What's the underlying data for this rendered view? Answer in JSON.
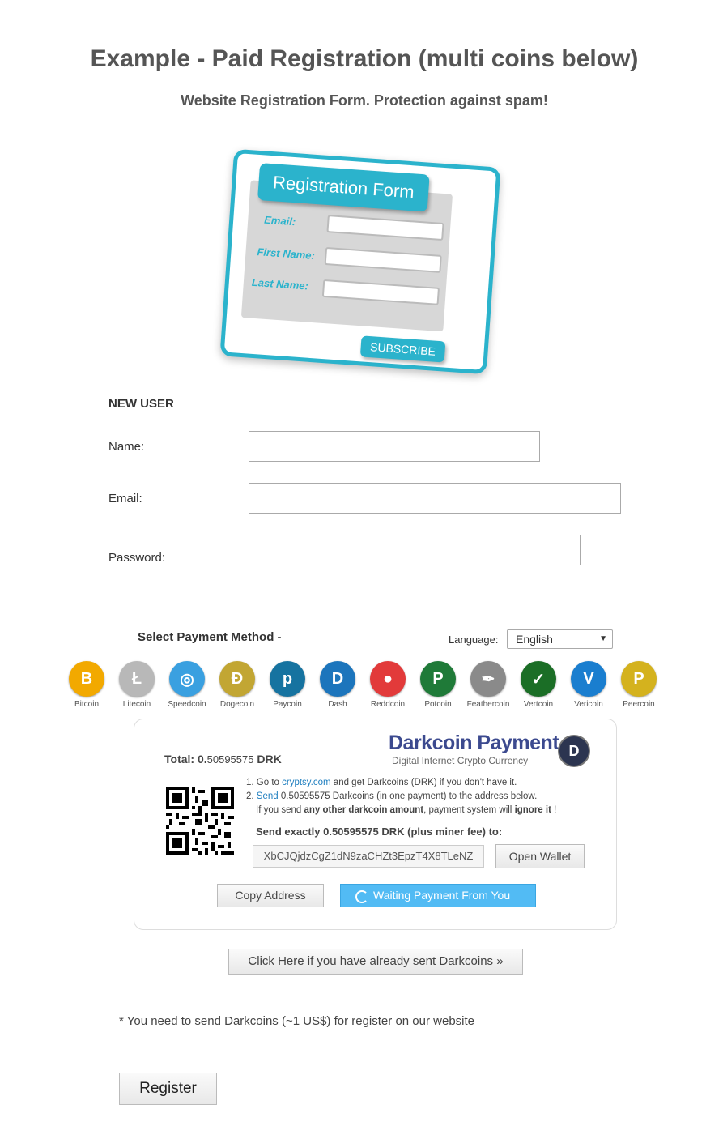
{
  "header": {
    "title": "Example - Paid Registration (multi coins below)",
    "subtitle": "Website Registration Form. Protection against spam!"
  },
  "illustration": {
    "tab": "Registration Form",
    "email_label": "Email:",
    "first_label": "First Name:",
    "last_label": "Last Name:",
    "button": "SUBSCRIBE",
    "accent": "#2bb3cc"
  },
  "form": {
    "heading": "NEW USER",
    "name_label": "Name:",
    "email_label": "Email:",
    "password_label": "Password:",
    "name_value": "",
    "email_value": "",
    "password_value": ""
  },
  "payment": {
    "select_label": "Select Payment Method -",
    "language_label": "Language:",
    "language_value": "English",
    "coins": [
      {
        "name": "Bitcoin",
        "glyph": "B",
        "color": "#f2a900"
      },
      {
        "name": "Litecoin",
        "glyph": "Ł",
        "color": "#b8b8b8"
      },
      {
        "name": "Speedcoin",
        "glyph": "◎",
        "color": "#3aa0e0"
      },
      {
        "name": "Dogecoin",
        "glyph": "Ð",
        "color": "#c2a633"
      },
      {
        "name": "Paycoin",
        "glyph": "p",
        "color": "#1673a0"
      },
      {
        "name": "Dash",
        "glyph": "D",
        "color": "#1c75bc"
      },
      {
        "name": "Reddcoin",
        "glyph": "●",
        "color": "#e23a3a"
      },
      {
        "name": "Potcoin",
        "glyph": "P",
        "color": "#1f7a38"
      },
      {
        "name": "Feathercoin",
        "glyph": "✒",
        "color": "#8a8a8a"
      },
      {
        "name": "Vertcoin",
        "glyph": "✓",
        "color": "#1b6e26"
      },
      {
        "name": "Vericoin",
        "glyph": "V",
        "color": "#1a7ecf"
      },
      {
        "name": "Peercoin",
        "glyph": "P",
        "color": "#d4b21e"
      }
    ]
  },
  "box": {
    "total_label": "Total: 0.",
    "total_num": "50595575",
    "total_unit": " DRK",
    "logo": "Darkcoin Payment",
    "tagline": "Digital Internet Crypto Currency",
    "logo_glyph": "D",
    "step1_pre": "1. Go to ",
    "step1_link": "cryptsy.com",
    "step1_post": " and get Darkcoins (DRK) if you don't have it.",
    "step2_pre": "2. ",
    "step2_link": "Send",
    "step2_post": " 0.50595575 Darkcoins (in one payment) to the address below.",
    "step3_a": "If you send ",
    "step3_b": "any other darkcoin amount",
    "step3_c": ", payment system will ",
    "step3_d": "ignore it",
    "step3_e": " !",
    "send_exact": "Send exactly 0.50595575 DRK (plus miner fee) to:",
    "address": "XbCJQjdzCgZ1dN9zaCHZt3EpzT4X8TLeNZ",
    "open_wallet": "Open Wallet",
    "copy_address": "Copy Address",
    "waiting": "Waiting Payment From You"
  },
  "footer": {
    "click_here": "Click Here if you have already sent Darkcoins »",
    "note": "* You need to send Darkcoins (~1 US$) for register on our website",
    "register": "Register"
  }
}
